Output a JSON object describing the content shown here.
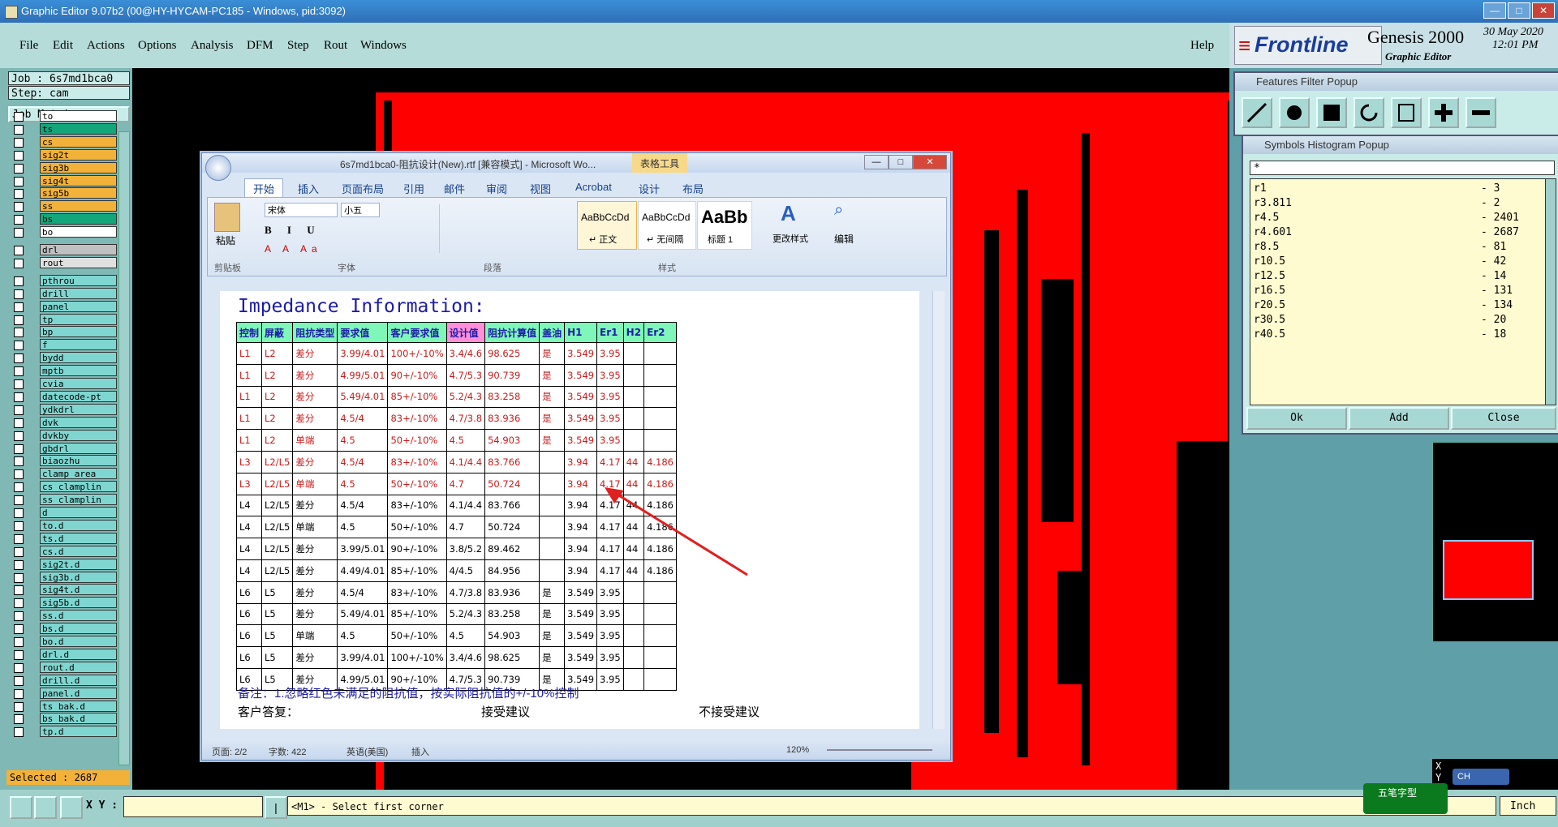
{
  "window": {
    "title": "Graphic Editor 9.07b2 (00@HY-HYCAM-PC185 - Windows, pid:3092)"
  },
  "menu": {
    "items": [
      "File",
      "Edit",
      "Actions",
      "Options",
      "Analysis",
      "DFM",
      "Step",
      "Rout",
      "Windows"
    ],
    "help": "Help"
  },
  "brand": {
    "logo": "Frontline",
    "product": "Genesis 2000",
    "sub": "Graphic Editor",
    "date": "30 May 2020",
    "time": "12:01 PM"
  },
  "job": {
    "job_label": "Job :  6s7md1bca0",
    "step_label": "Step: cam",
    "matrix_button": "Job Matrix ..."
  },
  "layers": [
    {
      "name": "to",
      "color": "#ffffff"
    },
    {
      "name": "ts",
      "color": "#12a67a"
    },
    {
      "name": "cs",
      "color": "#f2b23a"
    },
    {
      "name": "sig2t",
      "color": "#f2b23a"
    },
    {
      "name": "sig3b",
      "color": "#f2b23a"
    },
    {
      "name": "sig4t",
      "color": "#f2b23a"
    },
    {
      "name": "sig5b",
      "color": "#f2b23a"
    },
    {
      "name": "ss",
      "color": "#f2b23a"
    },
    {
      "name": "bs",
      "color": "#12a67a"
    },
    {
      "name": "bo",
      "color": "#ffffff"
    },
    {
      "name": "drl",
      "color": "#c0c0c0"
    },
    {
      "name": "rout",
      "color": "#e0e0e0"
    },
    {
      "name": "pthrou",
      "color": "#7fd6d0"
    },
    {
      "name": "drill",
      "color": "#7fd6d0"
    },
    {
      "name": "panel",
      "color": "#7fd6d0"
    },
    {
      "name": "tp",
      "color": "#7fd6d0"
    },
    {
      "name": "bp",
      "color": "#7fd6d0"
    },
    {
      "name": "f",
      "color": "#7fd6d0"
    },
    {
      "name": "bydd",
      "color": "#7fd6d0"
    },
    {
      "name": "mptb",
      "color": "#7fd6d0"
    },
    {
      "name": "cvia",
      "color": "#7fd6d0"
    },
    {
      "name": "datecode-pt",
      "color": "#7fd6d0"
    },
    {
      "name": "ydkdrl",
      "color": "#7fd6d0"
    },
    {
      "name": "dvk",
      "color": "#7fd6d0"
    },
    {
      "name": "dvkby",
      "color": "#7fd6d0"
    },
    {
      "name": "gbdrl",
      "color": "#7fd6d0"
    },
    {
      "name": "biaozhu",
      "color": "#7fd6d0"
    },
    {
      "name": "clamp_area",
      "color": "#7fd6d0"
    },
    {
      "name": "cs_clamplin",
      "color": "#7fd6d0"
    },
    {
      "name": "ss_clamplin",
      "color": "#7fd6d0"
    },
    {
      "name": "d",
      "color": "#7fd6d0"
    },
    {
      "name": "to.d",
      "color": "#7fd6d0"
    },
    {
      "name": "ts.d",
      "color": "#7fd6d0"
    },
    {
      "name": "cs.d",
      "color": "#7fd6d0"
    },
    {
      "name": "sig2t.d",
      "color": "#7fd6d0"
    },
    {
      "name": "sig3b.d",
      "color": "#7fd6d0"
    },
    {
      "name": "sig4t.d",
      "color": "#7fd6d0"
    },
    {
      "name": "sig5b.d",
      "color": "#7fd6d0"
    },
    {
      "name": "ss.d",
      "color": "#7fd6d0"
    },
    {
      "name": "bs.d",
      "color": "#7fd6d0"
    },
    {
      "name": "bo.d",
      "color": "#7fd6d0"
    },
    {
      "name": "drl.d",
      "color": "#7fd6d0"
    },
    {
      "name": "rout.d",
      "color": "#7fd6d0"
    },
    {
      "name": "drill.d",
      "color": "#7fd6d0"
    },
    {
      "name": "panel.d",
      "color": "#7fd6d0"
    },
    {
      "name": "ts_bak.d",
      "color": "#7fd6d0"
    },
    {
      "name": "bs_bak.d",
      "color": "#7fd6d0"
    },
    {
      "name": "tp.d",
      "color": "#7fd6d0"
    }
  ],
  "status": {
    "selected": "Selected : 2687",
    "xy_label": "X Y :",
    "prompt": "<M1> - Select first corner",
    "units": "Inch",
    "xy_readout": "X\nY"
  },
  "word": {
    "title": "6s7md1bca0-阻抗设计(New).rtf [兼容模式] - Microsoft Wo...",
    "context_tab": "表格工具",
    "tabs": [
      "开始",
      "插入",
      "页面布局",
      "引用",
      "邮件",
      "审阅",
      "视图",
      "Acrobat",
      "设计",
      "布局"
    ],
    "font_name": "宋体",
    "font_size": "小五",
    "groups": [
      "剪贴板",
      "字体",
      "段落",
      "样式"
    ],
    "paste_label": "粘贴",
    "styles": [
      {
        "preview": "AaBbCcDd",
        "name": "↵ 正文"
      },
      {
        "preview": "AaBbCcDd",
        "name": "↵ 无间隔"
      },
      {
        "preview": "AaBb",
        "name": "标题 1"
      }
    ],
    "change_styles": "更改样式",
    "edit_label": "编辑",
    "heading": "Impedance Information:",
    "columns": [
      "控制",
      "屏蔽",
      "阻抗类型",
      "要求值",
      "客户要求值",
      "设计值",
      "阻抗计算值",
      "盖油",
      "H1",
      "Er1",
      "H2",
      "Er2"
    ],
    "rows": [
      [
        "L1",
        "L2",
        "差分",
        "3.99/4.01",
        "100+/-10%",
        "3.4/4.6",
        "98.625",
        "是",
        "3.549",
        "3.95",
        "",
        ""
      ],
      [
        "L1",
        "L2",
        "差分",
        "4.99/5.01",
        "90+/-10%",
        "4.7/5.3",
        "90.739",
        "是",
        "3.549",
        "3.95",
        "",
        ""
      ],
      [
        "L1",
        "L2",
        "差分",
        "5.49/4.01",
        "85+/-10%",
        "5.2/4.3",
        "83.258",
        "是",
        "3.549",
        "3.95",
        "",
        ""
      ],
      [
        "L1",
        "L2",
        "差分",
        "4.5/4",
        "83+/-10%",
        "4.7/3.8",
        "83.936",
        "是",
        "3.549",
        "3.95",
        "",
        ""
      ],
      [
        "L1",
        "L2",
        "单端",
        "4.5",
        "50+/-10%",
        "4.5",
        "54.903",
        "是",
        "3.549",
        "3.95",
        "",
        ""
      ],
      [
        "L3",
        "L2/L5",
        "差分",
        "4.5/4",
        "83+/-10%",
        "4.1/4.4",
        "83.766",
        "",
        "3.94",
        "4.17",
        "44",
        "4.186"
      ],
      [
        "L3",
        "L2/L5",
        "单端",
        "4.5",
        "50+/-10%",
        "4.7",
        "50.724",
        "",
        "3.94",
        "4.17",
        "44",
        "4.186"
      ],
      [
        "L4",
        "L2/L5",
        "差分",
        "4.5/4",
        "83+/-10%",
        "4.1/4.4",
        "83.766",
        "",
        "3.94",
        "4.17",
        "44",
        "4.186"
      ],
      [
        "L4",
        "L2/L5",
        "单端",
        "4.5",
        "50+/-10%",
        "4.7",
        "50.724",
        "",
        "3.94",
        "4.17",
        "44",
        "4.186"
      ],
      [
        "L4",
        "L2/L5",
        "差分",
        "3.99/5.01",
        "90+/-10%",
        "3.8/5.2",
        "89.462",
        "",
        "3.94",
        "4.17",
        "44",
        "4.186"
      ],
      [
        "L4",
        "L2/L5",
        "差分",
        "4.49/4.01",
        "85+/-10%",
        "4/4.5",
        "84.956",
        "",
        "3.94",
        "4.17",
        "44",
        "4.186"
      ],
      [
        "L6",
        "L5",
        "差分",
        "4.5/4",
        "83+/-10%",
        "4.7/3.8",
        "83.936",
        "是",
        "3.549",
        "3.95",
        "",
        ""
      ],
      [
        "L6",
        "L5",
        "差分",
        "5.49/4.01",
        "85+/-10%",
        "5.2/4.3",
        "83.258",
        "是",
        "3.549",
        "3.95",
        "",
        ""
      ],
      [
        "L6",
        "L5",
        "单端",
        "4.5",
        "50+/-10%",
        "4.5",
        "54.903",
        "是",
        "3.549",
        "3.95",
        "",
        ""
      ],
      [
        "L6",
        "L5",
        "差分",
        "3.99/4.01",
        "100+/-10%",
        "3.4/4.6",
        "98.625",
        "是",
        "3.549",
        "3.95",
        "",
        ""
      ],
      [
        "L6",
        "L5",
        "差分",
        "4.99/5.01",
        "90+/-10%",
        "4.7/5.3",
        "90.739",
        "是",
        "3.549",
        "3.95",
        "",
        ""
      ]
    ],
    "red_rows": 7,
    "note": "备注：1.忽略红色未满足的阻抗值，按实际阻抗值的+/-10%控制",
    "reply": "客户答复：",
    "accept": "接受建议",
    "reject": "不接受建议",
    "statusbar": {
      "page": "页面: 2/2",
      "words": "字数: 422",
      "lang": "英语(美国)",
      "mode": "插入",
      "zoom": "120%"
    }
  },
  "features_filter": {
    "title": "Features Filter Popup"
  },
  "histogram": {
    "title": "Symbols Histogram Popup",
    "filter": "*",
    "items": [
      {
        "sym": "r1",
        "count": "- 3"
      },
      {
        "sym": "r3.811",
        "count": "- 2"
      },
      {
        "sym": "r4.5",
        "count": "- 2401"
      },
      {
        "sym": "r4.601",
        "count": "- 2687"
      },
      {
        "sym": "r8.5",
        "count": "- 81"
      },
      {
        "sym": "r10.5",
        "count": "- 42"
      },
      {
        "sym": "r12.5",
        "count": "- 14"
      },
      {
        "sym": "r16.5",
        "count": "- 131"
      },
      {
        "sym": "r20.5",
        "count": "- 134"
      },
      {
        "sym": "r30.5",
        "count": "- 20"
      },
      {
        "sym": "r40.5",
        "count": "- 18"
      }
    ],
    "ok": "Ok",
    "add": "Add",
    "close": "Close"
  },
  "ime": {
    "label": "五笔字型",
    "lang": "CH"
  }
}
